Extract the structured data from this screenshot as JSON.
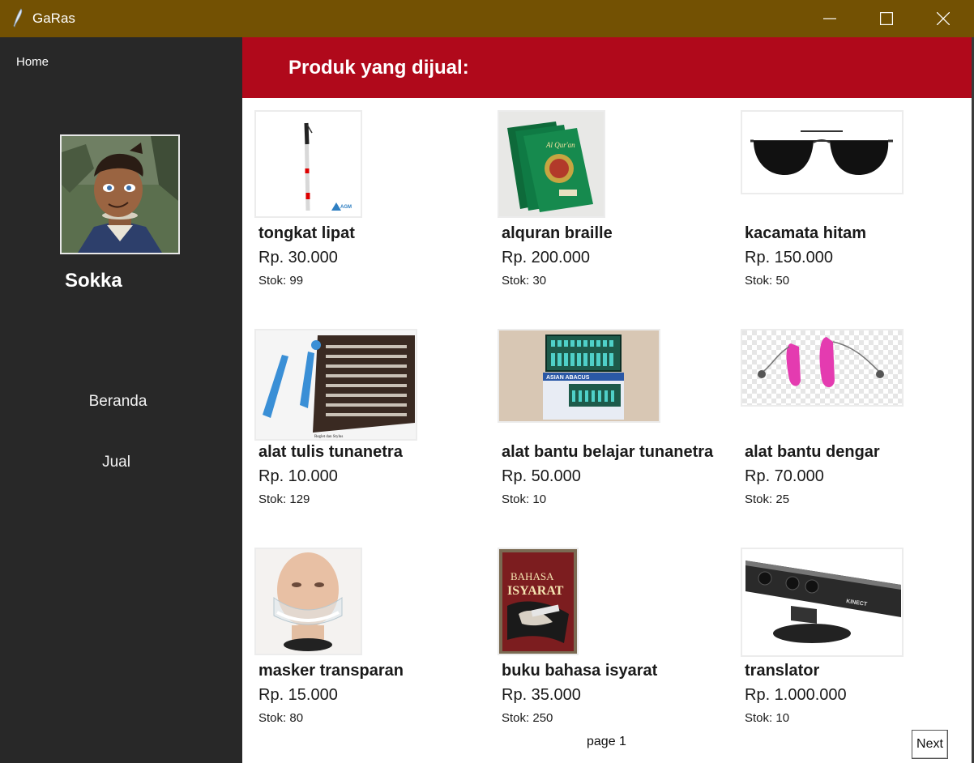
{
  "window": {
    "title": "GaRas",
    "title_bar_color": "#735103"
  },
  "sidebar": {
    "home_label": "Home",
    "user_name": "Sokka",
    "nav": [
      {
        "label": "Beranda"
      },
      {
        "label": "Jual"
      }
    ],
    "background": "#282828"
  },
  "header": {
    "title": "Produk yang dijual:",
    "color": "#b0091b"
  },
  "products": [
    {
      "name": "tongkat lipat",
      "price": "Rp. 30.000",
      "stock": "Stok: 99",
      "image": "white-cane-image",
      "logo_text": "AGM"
    },
    {
      "name": "alquran braille",
      "price": "Rp. 200.000",
      "stock": "Stok: 30",
      "image": "braille-quran-image",
      "cover_text": "Al Qur'an"
    },
    {
      "name": "kacamata hitam",
      "price": "Rp. 150.000",
      "stock": "Stok: 50",
      "image": "sunglasses-image"
    },
    {
      "name": "alat tulis tunanetra",
      "price": "Rp. 10.000",
      "stock": "Stok: 129",
      "image": "braille-slate-image",
      "caption": "Reglet dan Stylus"
    },
    {
      "name": "alat bantu belajar tunanetra",
      "price": "Rp. 50.000",
      "stock": "Stok: 10",
      "image": "abacus-image",
      "box_text": "ASIAN ABACUS"
    },
    {
      "name": "alat bantu dengar",
      "price": "Rp. 70.000",
      "stock": "Stok: 25",
      "image": "hearing-aid-image"
    },
    {
      "name": "masker transparan",
      "price": "Rp. 15.000",
      "stock": "Stok: 80",
      "image": "transparent-mask-image"
    },
    {
      "name": "buku bahasa isyarat",
      "price": "Rp. 35.000",
      "stock": "Stok: 250",
      "image": "sign-language-book-image",
      "cover_title_1": "BAHASA",
      "cover_title_2": "ISYARAT"
    },
    {
      "name": "translator",
      "price": "Rp. 1.000.000",
      "stock": "Stok: 10",
      "image": "kinect-translator-image",
      "device_text": "KINECT"
    }
  ],
  "pagination": {
    "page_label": "page 1",
    "next_label": "Next"
  }
}
